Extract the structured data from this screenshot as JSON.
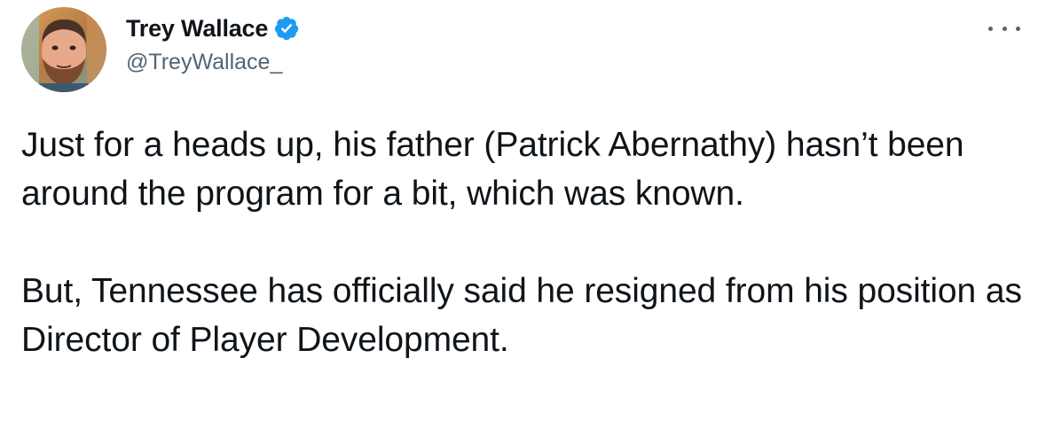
{
  "author": {
    "display_name": "Trey Wallace",
    "handle": "@TreyWallace_",
    "verified": true,
    "verified_color": "#1d9bf0",
    "avatar_icon": "profile-photo"
  },
  "menu": {
    "icon": "more-horizontal-icon"
  },
  "tweet": {
    "paragraph_1": "Just for a heads up, his father (Patrick Abernathy) hasn’t been around the program for a bit, which was known.",
    "paragraph_2": "But, Tennessee has officially said he resigned from his position as Director of Player Development."
  }
}
